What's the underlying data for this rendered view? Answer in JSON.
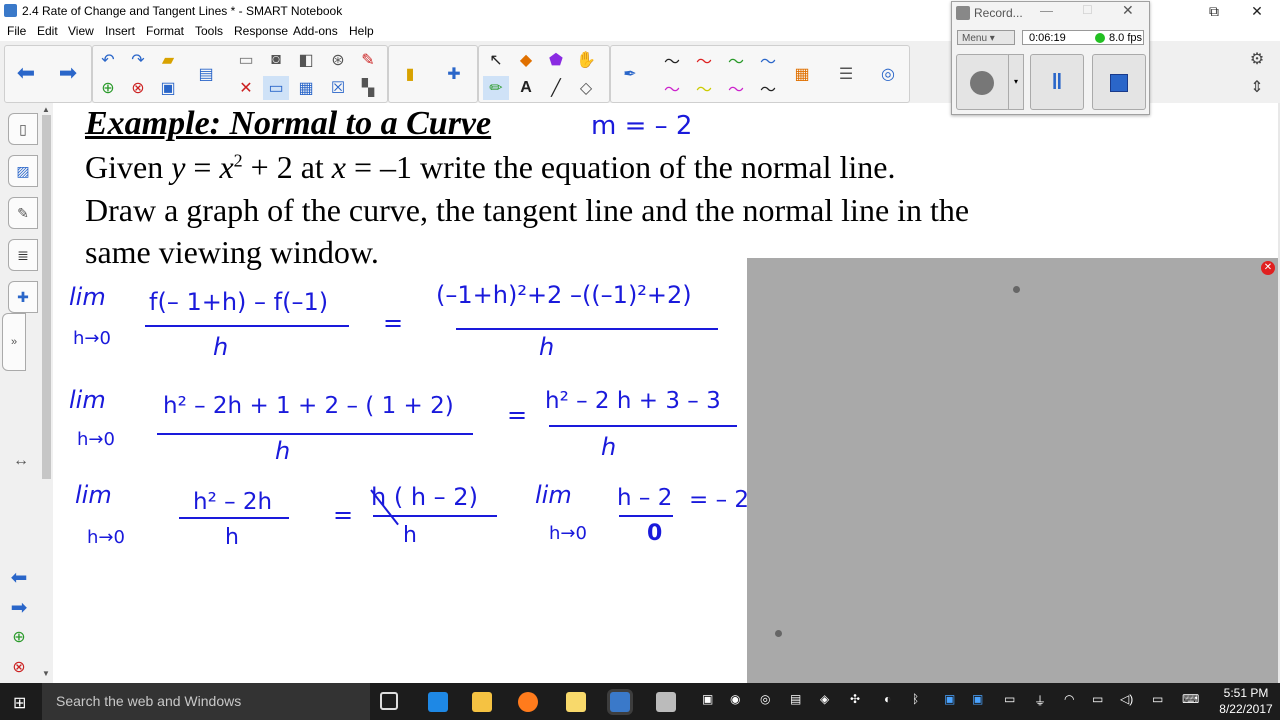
{
  "window": {
    "title": "2.4 Rate of Change and Tangent Lines * - SMART Notebook",
    "restore_glyph": "⧉",
    "close_glyph": "✕"
  },
  "menu": [
    "File",
    "Edit",
    "View",
    "Insert",
    "Format",
    "Tools",
    "Response",
    "Add-ons",
    "Help"
  ],
  "toolbar": {
    "icons": [
      "back-arrow-icon",
      "forward-arrow-icon",
      "undo-icon",
      "redo-icon",
      "open-folder-icon",
      "add-page-icon",
      "delete-page-icon",
      "save-icon",
      "screen-capture-icon",
      "paste-icon",
      "delete-icon",
      "screen-shade-icon",
      "table-icon",
      "close-icon",
      "document-camera-icon",
      "gallery-icon",
      "addons-icon",
      "select-icon",
      "shapes-icon",
      "fill-icon",
      "magic-pen-icon",
      "pens-icon",
      "text-icon",
      "line-icon",
      "eraser-icon",
      "highlighter-icon",
      "color-palette-icon",
      "properties-icon",
      "settings-icon",
      "move-toolbar-icon"
    ],
    "accent": "#2a66c9"
  },
  "recorder": {
    "title": "Record...",
    "menu_label": "Menu",
    "elapsed": "0:06:19",
    "fps": "8.0 fps",
    "status_color": "#22c022"
  },
  "slide": {
    "heading": "Example:  Normal to a Curve",
    "line1_pre": "Given ",
    "line1_y": "y",
    "line1_eq1": " = ",
    "line1_x": "x",
    "line1_exp": "2",
    "line1_mid": " + 2 at ",
    "line1_x2": "x",
    "line1_post": " = –1 write the equation of the normal line.",
    "line2": "Draw a graph of the curve, the tangent line and the normal line in the",
    "line3": "same viewing window.",
    "ink_slope": "m = – 2",
    "ink_lim1": "lim",
    "ink_h0_1": "h→0",
    "ink_num1": "f(– 1+h) – f(–1)",
    "ink_den1": "h",
    "ink_eq1": "=",
    "ink_num2": "(–1+h)²+2 –((–1)²+2)",
    "ink_den2": "h",
    "ink_lim2": "lim",
    "ink_h0_2": "h→0",
    "ink_num3": "h² – 2h + 1 + 2 – ( 1 + 2)",
    "ink_den3": "h",
    "ink_eq2": "=",
    "ink_num4": "h² – 2 h + 3 – 3",
    "ink_den4": "h",
    "ink_lim3": "lim",
    "ink_h0_3": "h→0",
    "ink_num5": "h² – 2h",
    "ink_den5": "h",
    "ink_eq3": "=",
    "ink_num6": "h ( h – 2)",
    "ink_den6": "h",
    "ink_lim4": "lim",
    "ink_h0_4": "h→0",
    "ink_num7": "h – 2",
    "ink_den7": "0",
    "ink_result": "= – 2",
    "ink_color": "#1a1adb"
  },
  "taskbar": {
    "search_placeholder": "Search the web and Windows",
    "time": "5:51 PM",
    "date": "8/22/2017"
  }
}
